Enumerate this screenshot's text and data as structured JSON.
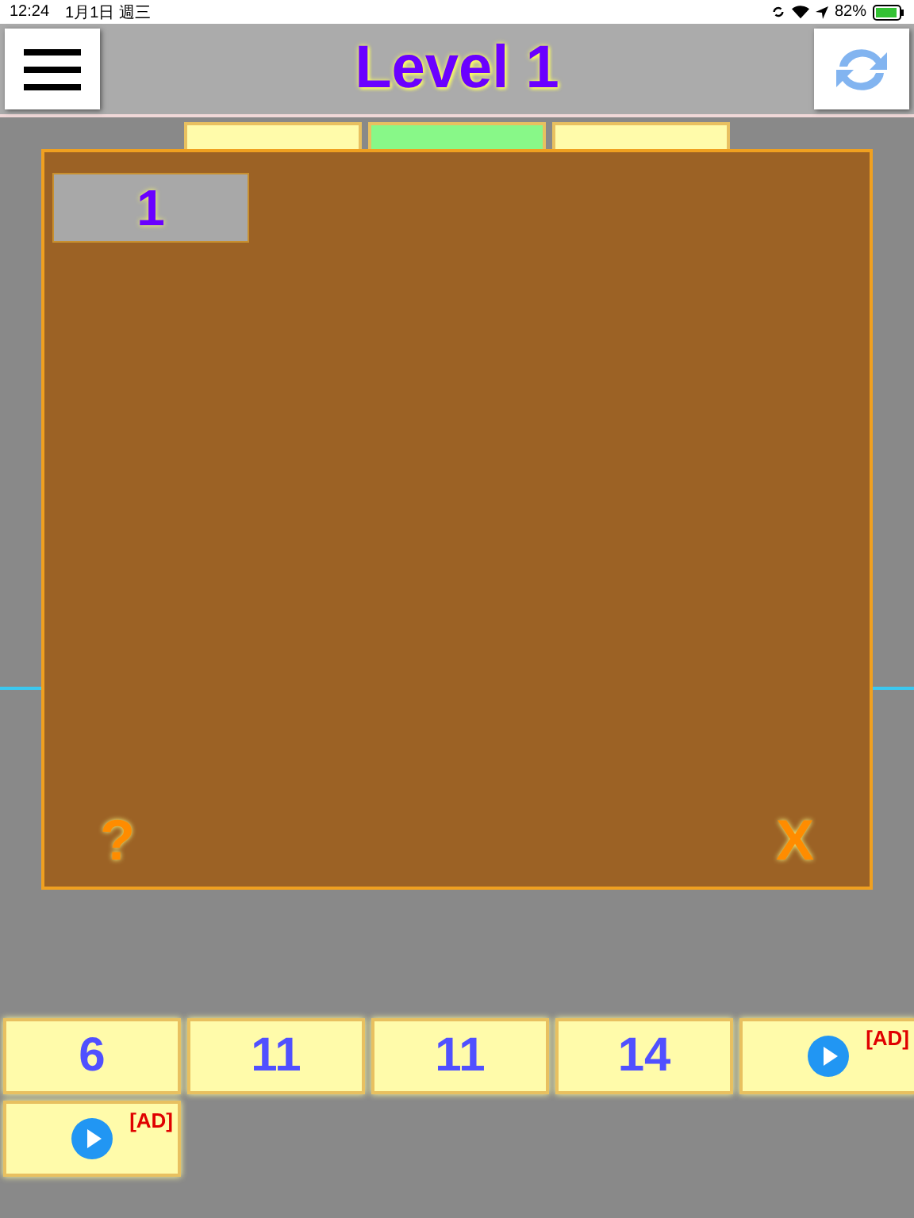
{
  "status_bar": {
    "time": "12:24",
    "date": "1月1日 週三",
    "battery": "82%"
  },
  "header": {
    "title": "Level 1"
  },
  "top_tiles": [
    {
      "color": "#fffbaa"
    },
    {
      "color": "#88f888"
    },
    {
      "color": "#fffbaa"
    }
  ],
  "dialog": {
    "items": [
      {
        "label": "1"
      }
    ],
    "help": "?",
    "close": "X"
  },
  "answer_tiles": [
    {
      "kind": "number",
      "label": "6"
    },
    {
      "kind": "number",
      "label": "11"
    },
    {
      "kind": "number",
      "label": "11"
    },
    {
      "kind": "number",
      "label": "14"
    },
    {
      "kind": "ad",
      "label": "[AD]"
    },
    {
      "kind": "ad",
      "label": "[AD]"
    }
  ]
}
